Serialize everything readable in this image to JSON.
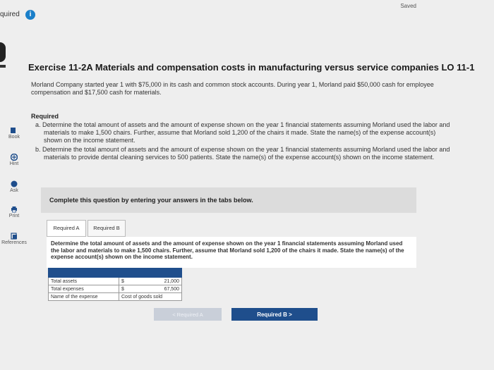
{
  "header": {
    "saved_label": "Saved",
    "quired_label": "quired",
    "info_glyph": "i"
  },
  "sidebar": {
    "items": [
      {
        "label": "Book",
        "icon": "book-icon"
      },
      {
        "label": "Hint",
        "icon": "hint-icon"
      },
      {
        "label": "Ask",
        "icon": "ask-icon"
      },
      {
        "label": "Print",
        "icon": "print-icon"
      },
      {
        "label": "References",
        "icon": "references-icon"
      }
    ]
  },
  "exercise": {
    "title": "Exercise 11-2A Materials and compensation costs in manufacturing versus service companies LO 11-1",
    "intro": "Morland Company started year 1 with $75,000 in its cash and common stock accounts. During year 1, Morland paid $50,000 cash for employee compensation and $17,500 cash for materials.",
    "required_heading": "Required",
    "requirements": [
      "a. Determine the total amount of assets and the amount of expense shown on the year 1 financial statements assuming Morland used the labor and materials to make 1,500 chairs. Further, assume that Morland sold 1,200 of the chairs it made. State the name(s) of the expense account(s) shown on the income statement.",
      "b. Determine the total amount of assets and the amount of expense shown on the year 1 financial statements assuming Morland used the labor and materials to provide dental cleaning services to 500 patients. State the name(s) of the expense account(s) shown on the income statement."
    ]
  },
  "answer_area": {
    "instruction": "Complete this question by entering your answers in the tabs below.",
    "tabs": [
      "Required A",
      "Required B"
    ],
    "active_tab": "Required A",
    "panel_text": "Determine the total amount of assets and the amount of expense shown on the year 1 financial statements assuming Morland used the labor and materials to make 1,500 chairs. Further, assume that Morland sold 1,200 of the chairs it made. State the name(s) of the expense account(s) shown on the income statement.",
    "rows": [
      {
        "label": "Total assets",
        "currency": "$",
        "value": "21,000"
      },
      {
        "label": "Total expenses",
        "currency": "$",
        "value": "67,500"
      },
      {
        "label": "Name of the expense",
        "currency": "",
        "value": "Cost of goods sold"
      }
    ],
    "prev_button": "< Required A",
    "next_button": "Required B  >"
  },
  "colors": {
    "accent": "#1f4e8c",
    "info": "#1a7fc9"
  }
}
